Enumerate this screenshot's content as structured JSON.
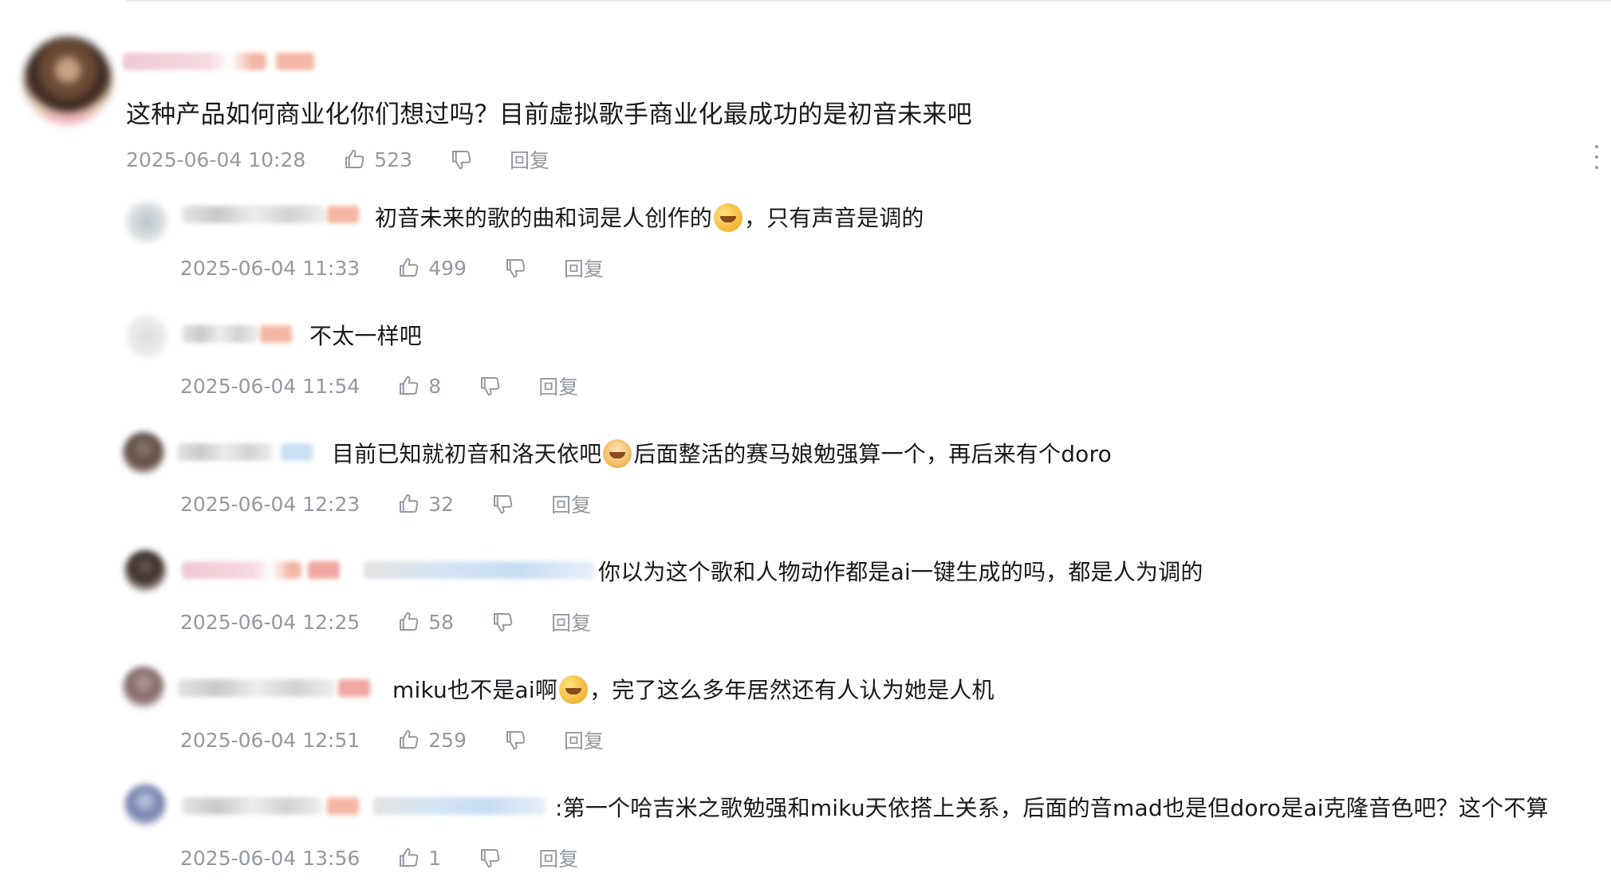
{
  "main_comment": {
    "text": "这种产品如何商业化你们想过吗？目前虚拟歌手商业化最成功的是初音未来吧",
    "time": "2025-06-04 10:28",
    "likes": "523",
    "reply_label": "回复"
  },
  "replies": [
    {
      "text": "初音未来的歌的曲和词是人创作的",
      "emoji": "crying-laughing",
      "text2": "，只有声音是调的",
      "time": "2025-06-04 11:33",
      "likes": "499",
      "reply_label": "回复"
    },
    {
      "text": "不太一样吧",
      "time": "2025-06-04 11:54",
      "likes": "8",
      "reply_label": "回复"
    },
    {
      "text": "目前已知就初音和洛天依吧",
      "emoji": "doge",
      "text2": "后面整活的赛马娘勉强算一个，再后来有个doro",
      "time": "2025-06-04 12:23",
      "likes": "32",
      "reply_label": "回复"
    },
    {
      "text": "你以为这个歌和人物动作都是ai一键生成的吗，都是人为调的",
      "time": "2025-06-04 12:25",
      "likes": "58",
      "reply_label": "回复"
    },
    {
      "text": "miku也不是ai啊",
      "emoji": "crying-laughing",
      "text2": "，完了这么多年居然还有人认为她是人机",
      "time": "2025-06-04 12:51",
      "likes": "259",
      "reply_label": "回复"
    },
    {
      "text": ":第一个哈吉米之歌勉强和miku天依搭上关系，后面的音mad也是但doro是ai克隆音色吧？这个不算",
      "time": "2025-06-04 13:56",
      "likes": "1",
      "reply_label": "回复"
    }
  ],
  "icons": {
    "like": "thumbs-up-icon",
    "dislike": "thumbs-down-icon",
    "more": "more-vertical-icon"
  }
}
